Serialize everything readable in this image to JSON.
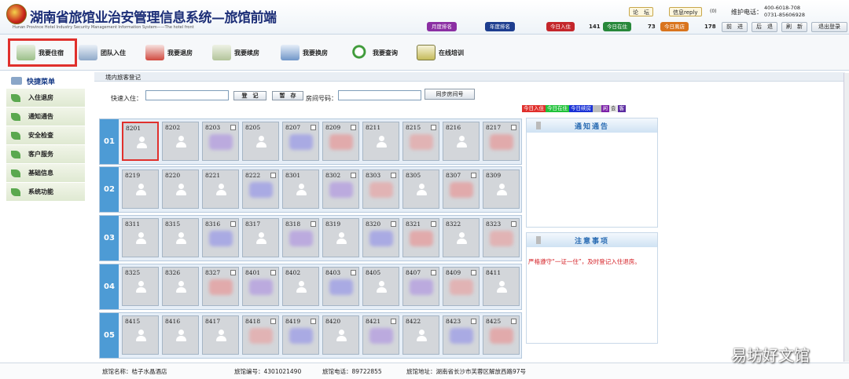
{
  "header": {
    "title_cn": "湖南省旅馆业治安管理信息系统—旅馆前端",
    "title_en": "Hunan Province Hotel Industry Security Management Information System——The hotel front",
    "month_rank": "月度排名",
    "year_rank": "年度排名",
    "today_in_label": "今日入住",
    "today_in": "141",
    "today_stay_label": "今日在住",
    "today_stay": "73",
    "today_out_label": "今日离店",
    "today_out": "178",
    "forum": "论　坛",
    "messages": "信息reply",
    "msg_count": "(0)",
    "hotline_label": "维护电话：",
    "hotline_1": "400-6018-708",
    "hotline_2": "0731-85606928",
    "nav": [
      "前　进",
      "后　退",
      "刷　新",
      "退出登录"
    ]
  },
  "toolbar": [
    "我要住宿",
    "团队入住",
    "我要退房",
    "我要续房",
    "我要换房",
    "我要查询",
    "在线培训"
  ],
  "sidebar": {
    "title": "快捷菜单",
    "items": [
      "入住退房",
      "通知通告",
      "安全检查",
      "客户服务",
      "基础信息",
      "系统功能"
    ]
  },
  "main": {
    "crumb": "境内旅客登记",
    "quick_label": "快速入住：",
    "btn_register": "登　记",
    "btn_stage": "暂　存",
    "room_label": "房间号码：",
    "btn_sync": "同步房间号",
    "legend": [
      "今日入住",
      "今日在住",
      "今日续房",
      "空",
      "闲",
      "会",
      "客"
    ],
    "floors": [
      {
        "label": "01",
        "rooms": [
          "8201",
          "8202",
          "8203",
          "8205",
          "8207",
          "8209",
          "8211",
          "8215",
          "8216",
          "8217"
        ]
      },
      {
        "label": "02",
        "rooms": [
          "8219",
          "8220",
          "8221",
          "8222",
          "8301",
          "8302",
          "8303",
          "8305",
          "8307",
          "8309"
        ]
      },
      {
        "label": "03",
        "rooms": [
          "8311",
          "8315",
          "8316",
          "8317",
          "8318",
          "8319",
          "8320",
          "8321",
          "8322",
          "8323"
        ]
      },
      {
        "label": "04",
        "rooms": [
          "8325",
          "8326",
          "8327",
          "8401",
          "8402",
          "8403",
          "8405",
          "8407",
          "8409",
          "8411"
        ]
      },
      {
        "label": "05",
        "rooms": [
          "8415",
          "8416",
          "8417",
          "8418",
          "8419",
          "8420",
          "8421",
          "8422",
          "8423",
          "8425"
        ]
      }
    ]
  },
  "notice": {
    "title": "通知通告"
  },
  "caution": {
    "title": "注意事项",
    "text": "严格遵守“一证一住”，及时登记入住退房。"
  },
  "footer": {
    "hotel_name": "旅馆名称：桔子水晶酒店",
    "hotel_no": "旅馆编号：4301021490",
    "hotel_phone": "旅馆电话：89722855",
    "hotel_addr": "旅馆地址：湖南省长沙市芙蓉区解放西路97号"
  },
  "watermark": "易坊好文馆",
  "colors": {
    "accent_blue": "#4d9bd5",
    "highlight_red": "#e0302c",
    "in_red": "#c4262b",
    "stay_green": "#27883a",
    "out_orange": "#d9741d"
  }
}
